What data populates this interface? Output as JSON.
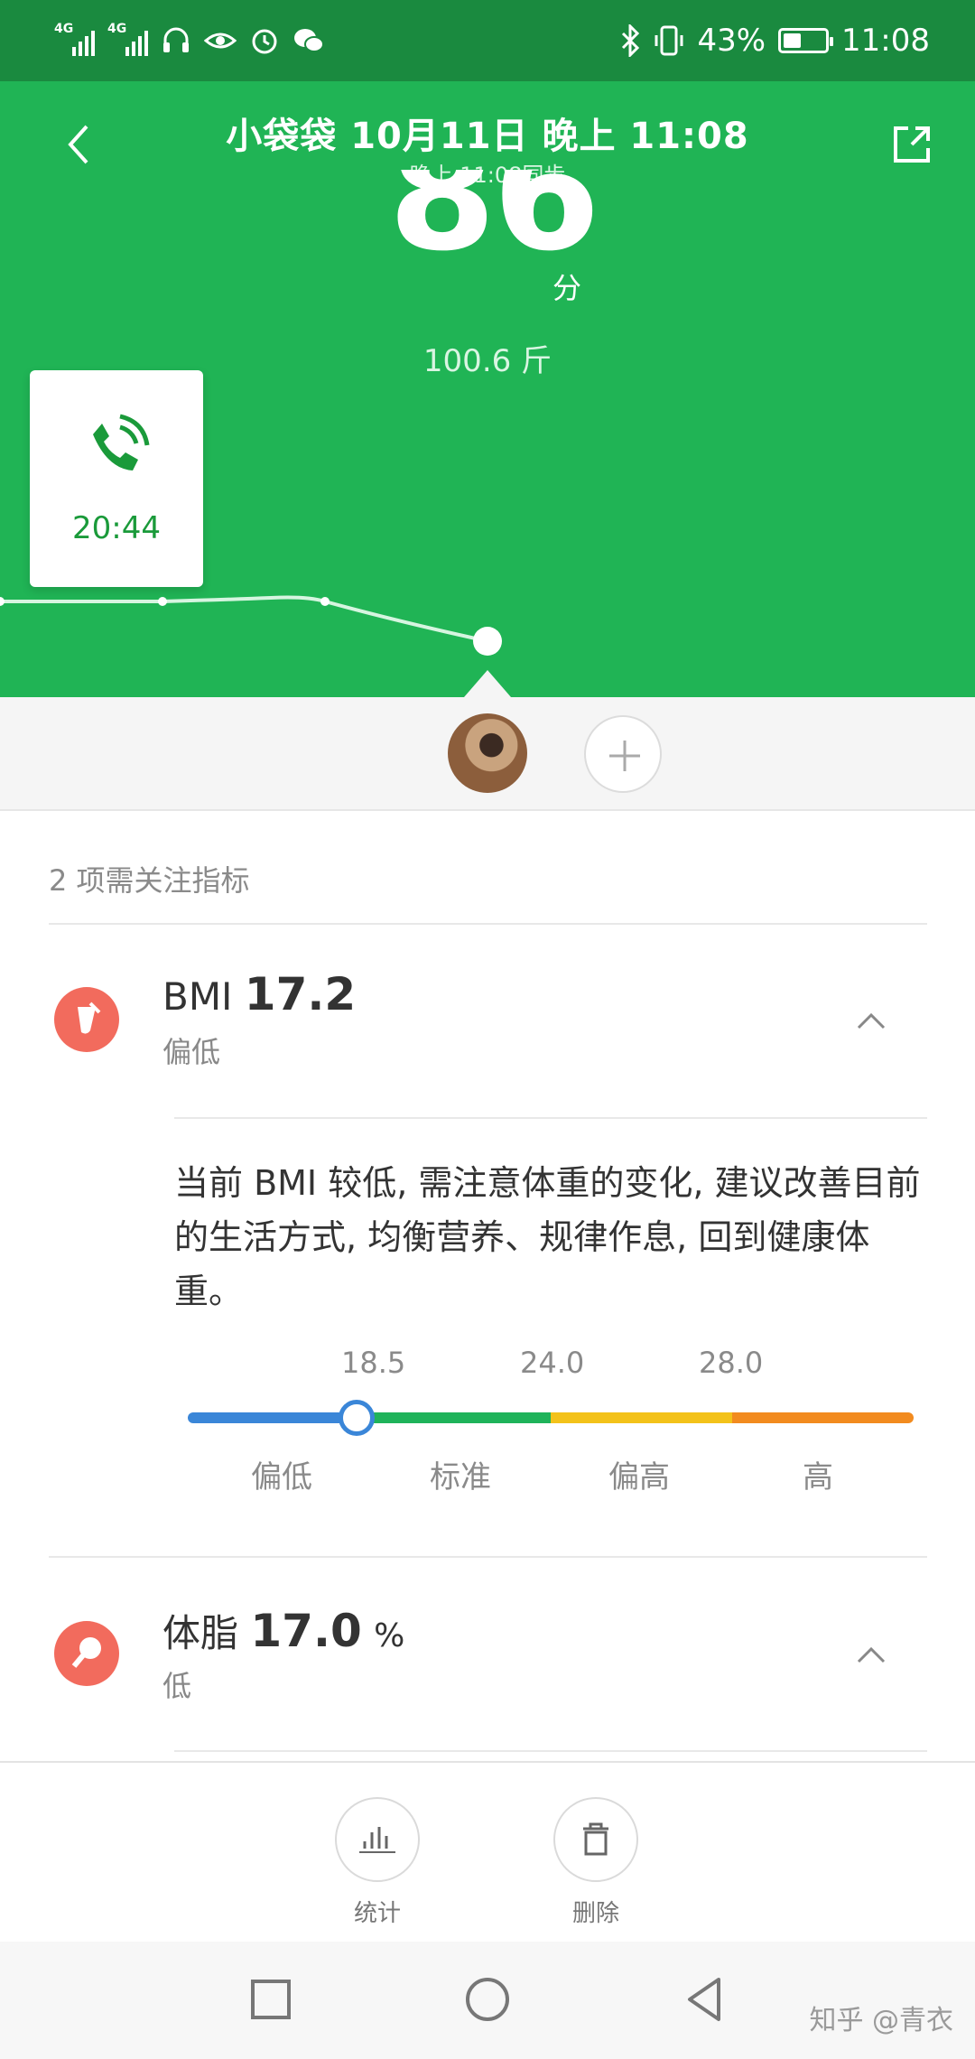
{
  "status_bar": {
    "network_1": "4G",
    "network_2": "4G",
    "battery_pct": "43%",
    "battery_level": 0.43,
    "time": "11:08"
  },
  "header": {
    "title": "小袋袋 10月11日 晚上 11:08",
    "sync_text": "晚上 11:08同步",
    "score": "86",
    "score_unit": "分",
    "weight": "100.6 斤",
    "call_time": "20:44",
    "bg_color": "#20b455"
  },
  "attention": {
    "title": "2 项需关注指标"
  },
  "metrics": [
    {
      "name": "BMI",
      "value": "17.2",
      "unit": "",
      "status": "偏低",
      "description": "当前 BMI 较低, 需注意体重的变化, 建议改善目前的生活方式, 均衡营养、规律作息, 回到健康体重。",
      "scale": {
        "ticks": [
          "18.5",
          "24.0",
          "28.0"
        ],
        "labels": [
          "偏低",
          "标准",
          "偏高",
          "高"
        ],
        "colors": [
          "#3a86d8",
          "#1fb35a",
          "#f3c21a",
          "#f28b1f"
        ]
      }
    },
    {
      "name": "体脂",
      "value": "17.0",
      "unit": "%",
      "status": "低"
    }
  ],
  "actions": {
    "stats": "统计",
    "delete": "删除"
  },
  "watermark": "知乎 @青衣"
}
